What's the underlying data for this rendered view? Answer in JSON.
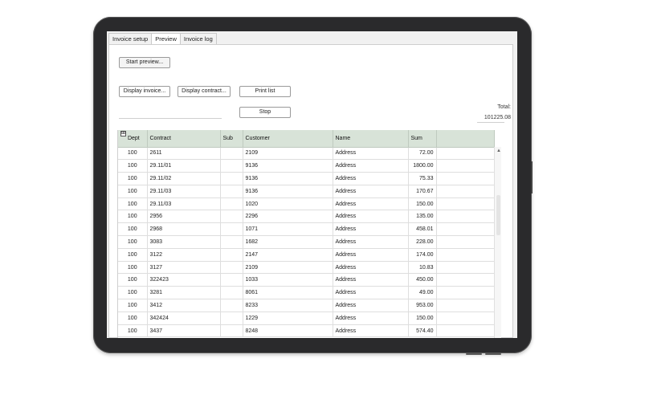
{
  "tabs": [
    {
      "label": "Invoice setup"
    },
    {
      "label": "Preview"
    },
    {
      "label": "Invoice log"
    }
  ],
  "buttons": {
    "start_preview": "Start preview...",
    "display_invoice": "Display invoice...",
    "display_contract": "Display contract...",
    "print_list": "Print list",
    "stop": "Stop"
  },
  "total": {
    "label": "Total:",
    "value": "101225.08"
  },
  "grid": {
    "corner_icon": "grid-options-icon",
    "columns": [
      "Dept",
      "Contract",
      "Sub",
      "Customer",
      "Name",
      "Sum"
    ],
    "rows": [
      {
        "dept": "100",
        "contract": "2611",
        "sub": "",
        "customer": "2109",
        "name": "Address",
        "sum": "72.00"
      },
      {
        "dept": "100",
        "contract": "29.11/01",
        "sub": "",
        "customer": "9136",
        "name": "Address",
        "sum": "1800.00"
      },
      {
        "dept": "100",
        "contract": "29.11/02",
        "sub": "",
        "customer": "9136",
        "name": "Address",
        "sum": "75.33"
      },
      {
        "dept": "100",
        "contract": "29.11/03",
        "sub": "",
        "customer": "9136",
        "name": "Address",
        "sum": "170.67"
      },
      {
        "dept": "100",
        "contract": "29.11/03",
        "sub": "",
        "customer": "1020",
        "name": "Address",
        "sum": "150.00"
      },
      {
        "dept": "100",
        "contract": "2956",
        "sub": "",
        "customer": "2296",
        "name": "Address",
        "sum": "135.00"
      },
      {
        "dept": "100",
        "contract": "2968",
        "sub": "",
        "customer": "1071",
        "name": "Address",
        "sum": "458.01"
      },
      {
        "dept": "100",
        "contract": "3083",
        "sub": "",
        "customer": "1682",
        "name": "Address",
        "sum": "228.00"
      },
      {
        "dept": "100",
        "contract": "3122",
        "sub": "",
        "customer": "2147",
        "name": "Address",
        "sum": "174.00"
      },
      {
        "dept": "100",
        "contract": "3127",
        "sub": "",
        "customer": "2109",
        "name": "Address",
        "sum": "10.83"
      },
      {
        "dept": "100",
        "contract": "322423",
        "sub": "",
        "customer": "1033",
        "name": "Address",
        "sum": "450.00"
      },
      {
        "dept": "100",
        "contract": "3281",
        "sub": "",
        "customer": "8061",
        "name": "Address",
        "sum": "49.00"
      },
      {
        "dept": "100",
        "contract": "3412",
        "sub": "",
        "customer": "8233",
        "name": "Address",
        "sum": "953.00"
      },
      {
        "dept": "100",
        "contract": "342424",
        "sub": "",
        "customer": "1229",
        "name": "Address",
        "sum": "150.00"
      },
      {
        "dept": "100",
        "contract": "3437",
        "sub": "",
        "customer": "8248",
        "name": "Address",
        "sum": "574.40"
      }
    ]
  },
  "colors": {
    "header_bg": "#d8e3d8",
    "device_frame": "#2a2a2c"
  }
}
